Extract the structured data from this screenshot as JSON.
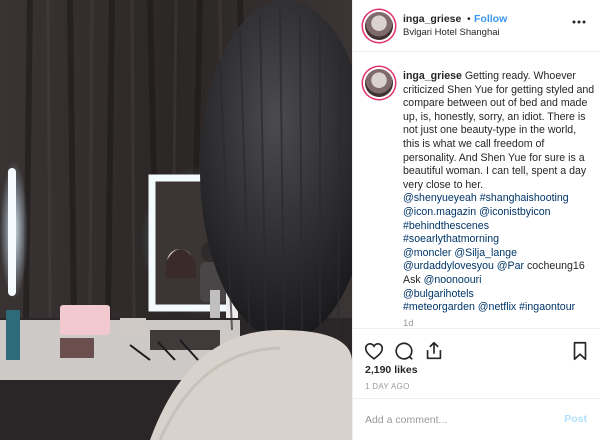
{
  "post": {
    "username": "inga_griese",
    "separator": "•",
    "follow_label": "Follow",
    "location": "Bvlgari Hotel Shanghai",
    "more_icon": "ellipsis-icon"
  },
  "caption": {
    "username": "inga_griese",
    "text": "Getting ready. Whoever criticized Shen Yue for getting styled and compare between out of bed and made up, is, honestly, sorry, an idiot. There is not just one beauty-type in the world, this is what we call freedom of personality. And Shen Yue for sure is a beautiful woman. I can tell, spent a day very close to her.",
    "tags_1": "@shenyueyeah #shanghaishooting",
    "tags_2": "@icon.magazin @iconistbyicon",
    "tags_3": "#behindthescenes",
    "tags_4": "#soearlythatmorning",
    "tags_5": "@moncler @Silja_lange",
    "tags_6a": "@urdaddylovesyou @Par",
    "tags_6b": " cocheung16",
    "tags_7a": "Ask ",
    "tags_7b": "@noonoouri",
    "tags_8": "@bulgarihotels",
    "tags_9": "#meteorgarden @netflix #ingaontour",
    "age": "1d"
  },
  "actions": {
    "like_icon": "heart-icon",
    "comment_icon": "comment-bubble-icon",
    "share_icon": "share-icon",
    "save_icon": "bookmark-icon"
  },
  "likes": "2,190 likes",
  "date": "1 DAY AGO",
  "comment_box": {
    "placeholder": "Add a comment...",
    "post_label": "Post"
  },
  "colors": {
    "link": "#003569",
    "follow": "#3897f0",
    "post_disabled": "#b2dffc"
  }
}
